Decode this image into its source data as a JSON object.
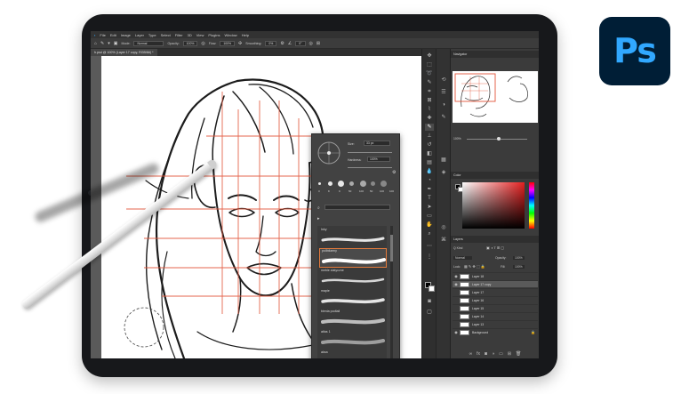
{
  "menubar": {
    "items": [
      "File",
      "Edit",
      "Image",
      "Layer",
      "Type",
      "Select",
      "Filter",
      "3D",
      "View",
      "Plugins",
      "Window",
      "Help"
    ]
  },
  "options": {
    "mode_label": "Mode:",
    "mode_value": "Normal",
    "opacity_label": "Opacity:",
    "opacity_value": "100%",
    "flow_label": "Flow:",
    "flow_value": "100%",
    "smoothing_label": "Smoothing:",
    "smoothing_value": "0%",
    "angle_value": "0°"
  },
  "document_tab": "h.psd @ 100% (Layer 17 copy, RGB/8#) *",
  "brush_panel": {
    "size_label": "Size:",
    "size_value": "33 px",
    "hardness_label": "Hardness:",
    "hardness_value": "100%",
    "tip_sizes": [
      "3",
      "8",
      "9",
      "50",
      "100",
      "50",
      "100",
      "100"
    ],
    "brushes": [
      "Inky",
      "pollbilaeny",
      "meble ziatyczne",
      "mapie",
      "bienia podtail",
      "atlas 1",
      "aksa",
      "blöka",
      "Smjeli",
      "sttvo 1"
    ],
    "selected_index": 1
  },
  "navigator": {
    "title": "Navigator",
    "zoom": "100%"
  },
  "color": {
    "title": "Color"
  },
  "layers": {
    "title": "Layers",
    "filter_label": "Q Kind",
    "blend": "Normal",
    "opacity_label": "Opacity:",
    "opacity_value": "100%",
    "lock_label": "Lock:",
    "fill_label": "Fill:",
    "fill_value": "100%",
    "items": [
      {
        "name": "Layer 18",
        "visible": true
      },
      {
        "name": "Layer 17 copy",
        "visible": true
      },
      {
        "name": "Layer 17",
        "visible": false
      },
      {
        "name": "Layer 16",
        "visible": false
      },
      {
        "name": "Layer 15",
        "visible": false
      },
      {
        "name": "Layer 14",
        "visible": false
      },
      {
        "name": "Layer 13",
        "visible": false
      },
      {
        "name": "Background",
        "visible": true
      }
    ],
    "selected_index": 1
  },
  "logo": {
    "text": "Ps",
    "bg": "#001e36",
    "fg": "#31a8ff"
  },
  "colors": {
    "accent": "#e27a3c",
    "guide": "#e2553a",
    "panel": "#3b3b3b",
    "menubar": "#323232"
  }
}
